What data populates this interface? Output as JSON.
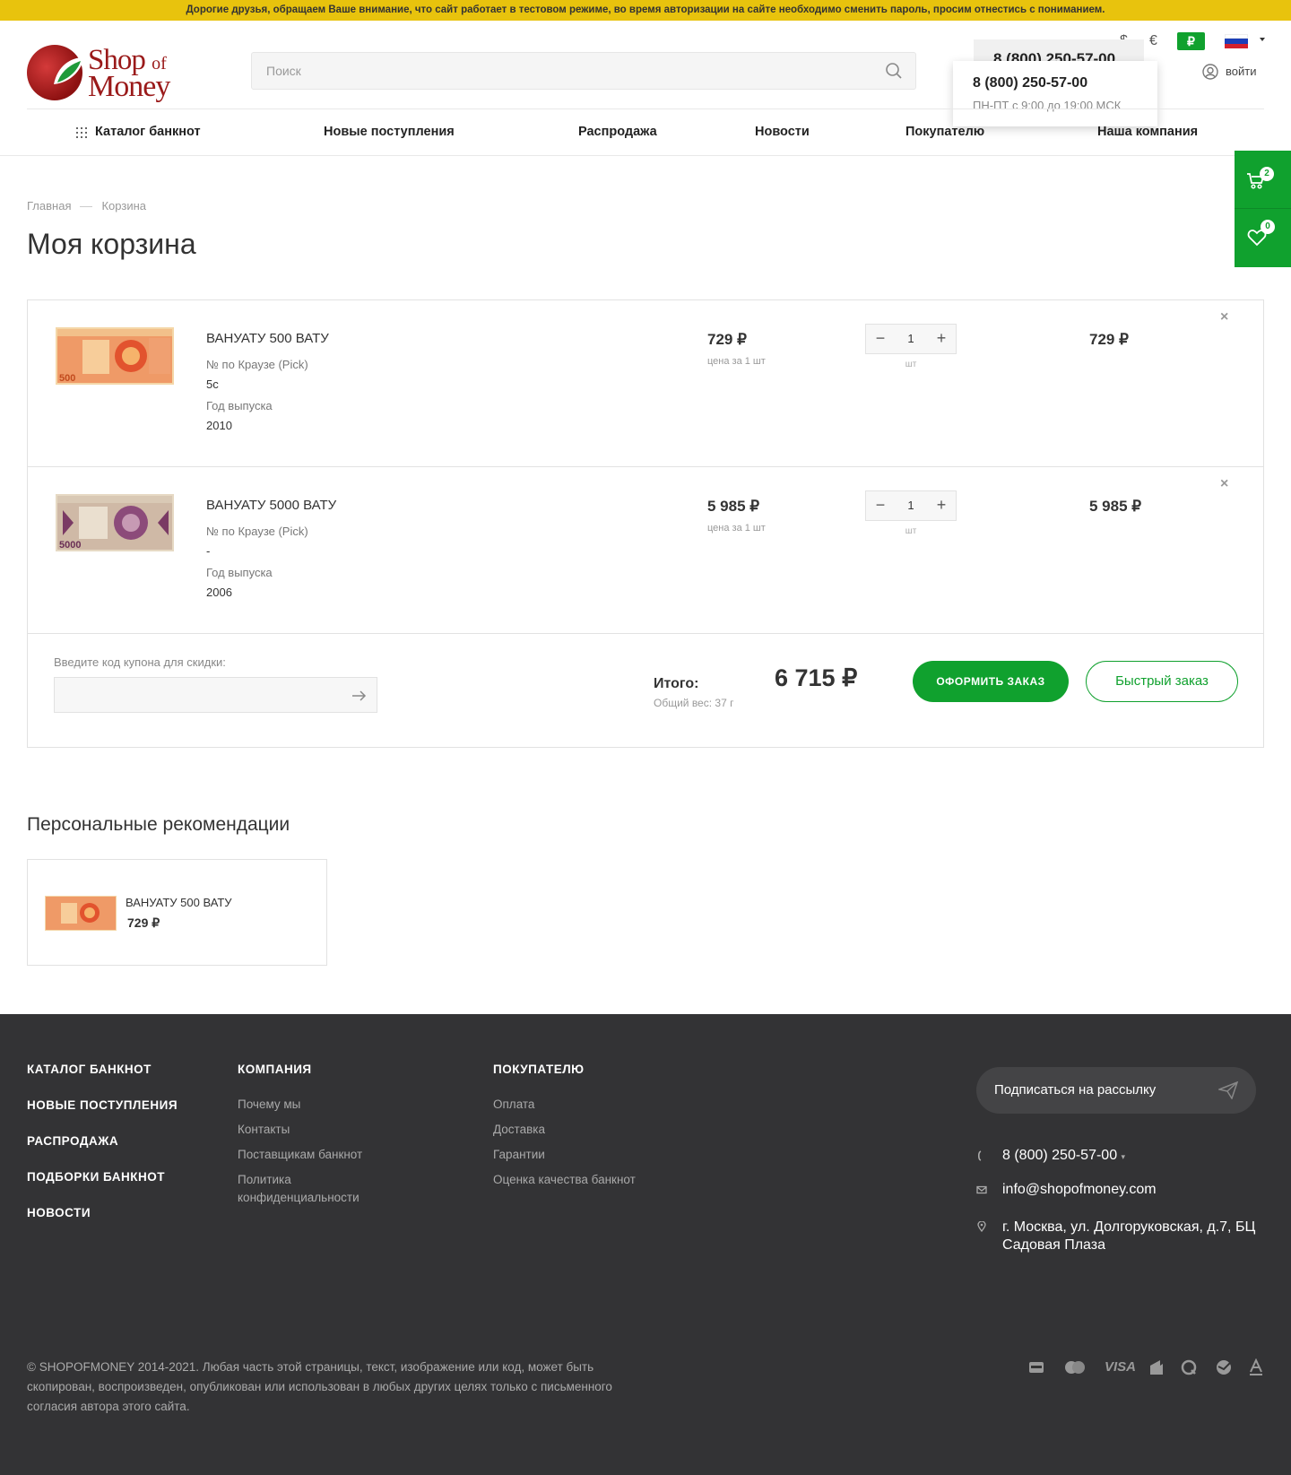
{
  "notice": "Дорогие друзья, обращаем Ваше внимание, что сайт работает в тестовом режиме, во время авторизации на сайте необходимо сменить пароль, просим отнестись с пониманием.",
  "logo": {
    "line1": "Shop",
    "line1_of": "of",
    "line2": "Money"
  },
  "search": {
    "placeholder": "Поиск"
  },
  "currencies": [
    "$",
    "€",
    "₽"
  ],
  "active_currency": "₽",
  "phone": {
    "number": "8 (800) 250-57-00",
    "hours": "ПН-ПТ с 9:00 до 19:00 МСК"
  },
  "login_label": "войти",
  "nav": [
    "Каталог банкнот",
    "Новые поступления",
    "Распродажа",
    "Новости",
    "Покупателю",
    "Наша компания"
  ],
  "side": {
    "cart_count": "2",
    "fav_count": "0"
  },
  "breadcrumb": [
    "Главная",
    "Корзина"
  ],
  "page_title": "Моя корзина",
  "cart": {
    "items": [
      {
        "name": "ВАНУАТУ 500 ВАТУ",
        "pick_label": "№ по Краузе (Pick)",
        "pick": "5с",
        "year_label": "Год выпуска",
        "year": "2010",
        "price": "729 ₽",
        "price_unit": "цена за 1 шт",
        "qty": "1",
        "qty_unit": "шт",
        "total": "729 ₽",
        "denom": "500"
      },
      {
        "name": "ВАНУАТУ 5000 ВАТУ",
        "pick_label": "№ по Краузе (Pick)",
        "pick": "-",
        "year_label": "Год выпуска",
        "year": "2006",
        "price": "5 985 ₽",
        "price_unit": "цена за 1 шт",
        "qty": "1",
        "qty_unit": "шт",
        "total": "5 985 ₽",
        "denom": "5000"
      }
    ],
    "coupon_label": "Введите код купона для скидки:",
    "total_label": "Итого:",
    "weight": "Общий вес: 37 г",
    "sum": "6 715 ₽",
    "order_btn": "ОФОРМИТЬ ЗАКАЗ",
    "fast_btn": "Быстрый заказ"
  },
  "recommendations": {
    "title": "Персональные рекомендации",
    "item": {
      "name": "ВАНУАТУ 500 ВАТУ",
      "price": "729 ₽"
    }
  },
  "footer": {
    "col1": [
      "КАТАЛОГ БАНКНОТ",
      "НОВЫЕ ПОСТУПЛЕНИЯ",
      "РАСПРОДАЖА",
      "ПОДБОРКИ БАНКНОТ",
      "НОВОСТИ"
    ],
    "company": {
      "title": "КОМПАНИЯ",
      "links": [
        "Почему мы",
        "Контакты",
        "Поставщикам банкнот",
        "Политика конфиденциальности"
      ]
    },
    "buyer": {
      "title": "ПОКУПАТЕЛЮ",
      "links": [
        "Оплата",
        "Доставка",
        "Гарантии",
        "Оценка качества банкнот"
      ]
    },
    "subscribe": "Подписаться на рассылку",
    "phone": "8 (800) 250-57-00",
    "email": "info@shopofmoney.com",
    "address": "г. Москва, ул. Долгоруковская, д.7, БЦ Садовая Плаза",
    "copyright": "© SHOPOFMONEY 2014-2021. Любая часть этой страницы, текст, изображение или код, может быть скопирован, воспроизведен, опубликован или использован в любых других целях только с письменного согласия автора этого сайта.",
    "payments": [
      "mir-icon",
      "mastercard-icon",
      "visa-icon",
      "yandex-icon",
      "qiwi-icon",
      "sber-icon",
      "alfa-icon"
    ],
    "visa_text": "VISA"
  },
  "colors": {
    "accent": "#10a12e",
    "notice": "#e8c30d",
    "footer": "#333335"
  }
}
